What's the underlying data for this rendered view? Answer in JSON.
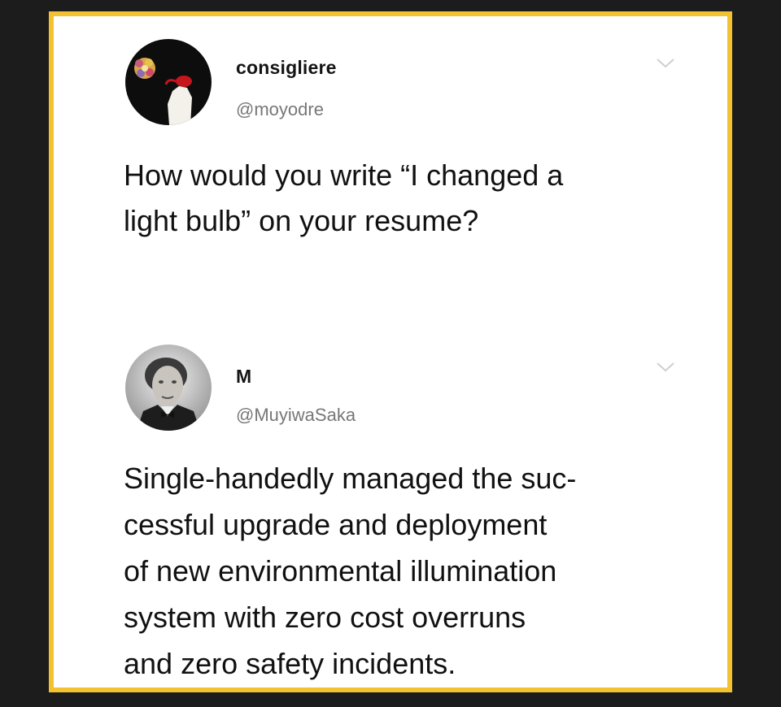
{
  "tweets": [
    {
      "display_name": "consigliere",
      "handle": "@moyodre",
      "avatar_icon": "flower-headed-figure-avatar",
      "menu_icon": "chevron-down-icon",
      "text": "How would you write “I changed a\nlight bulb” on your resume?"
    },
    {
      "display_name": "M",
      "handle": "@MuyiwaSaka",
      "avatar_icon": "vintage-portrait-avatar",
      "menu_icon": "chevron-down-icon",
      "text": "Single-handedly managed the suc-\ncessful upgrade and deployment\nof new environmental illumination\nsystem with zero cost overruns\nand zero safety incidents."
    }
  ],
  "colors": {
    "frame_border": "#f3c230",
    "background": "#1c1c1c",
    "card": "#ffffff",
    "handle": "#777777"
  }
}
